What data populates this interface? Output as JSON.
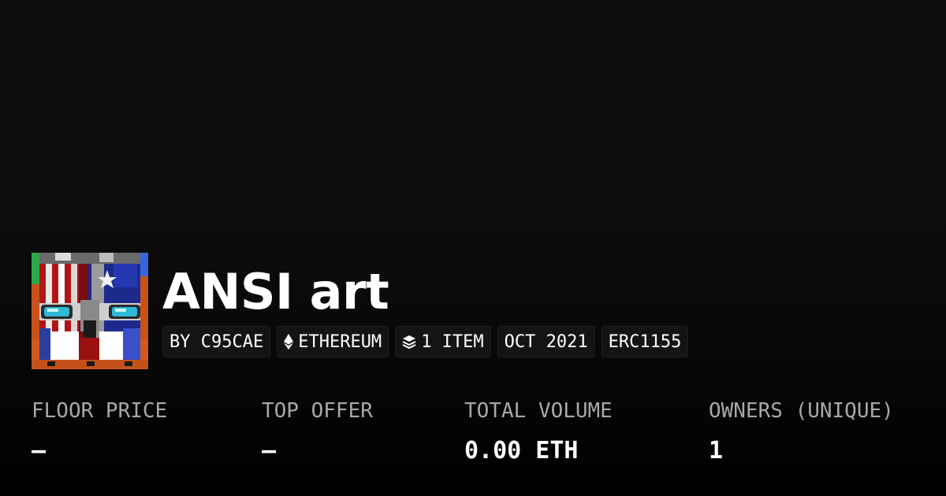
{
  "collection": {
    "title": "ANSI art",
    "avatar_icon": "ansi-art-face-icon"
  },
  "tags": {
    "creator": "BY C95CAE",
    "chain": "ETHEREUM",
    "chain_icon": "ethereum-icon",
    "items": "1 ITEM",
    "items_icon": "layers-icon",
    "date": "OCT 2021",
    "standard": "ERC1155"
  },
  "stats": {
    "floor_price": {
      "label": "FLOOR PRICE",
      "value": "–"
    },
    "top_offer": {
      "label": "TOP OFFER",
      "value": "–"
    },
    "total_volume": {
      "label": "TOTAL VOLUME",
      "value": "0.00 ETH"
    },
    "owners": {
      "label": "OWNERS (UNIQUE)",
      "value": "1"
    }
  },
  "colors": {
    "background": "#0b0b0b",
    "text": "#ffffff",
    "label": "#a8a8a8",
    "tag_background": "#141414"
  }
}
